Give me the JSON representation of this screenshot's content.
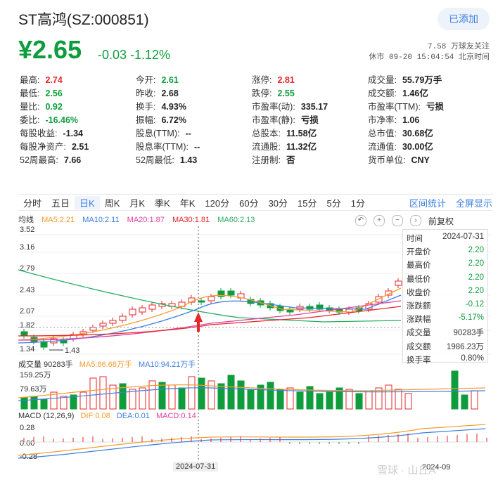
{
  "header": {
    "title": "ST高鸿(SZ:000851)",
    "add_button": "已添加",
    "price": "¥2.65",
    "change": "-0.03 -1.12%",
    "followers": "7.58 万球友关注",
    "market_status": "休市 09-20 15:04:54 北京时间"
  },
  "stats": [
    [
      {
        "label": "最高:",
        "value": "2.74",
        "color": "red"
      },
      {
        "label": "今开:",
        "value": "2.61",
        "color": "green"
      },
      {
        "label": "涨停:",
        "value": "2.81",
        "color": "red"
      },
      {
        "label": "成交量:",
        "value": "55.79万手",
        "color": ""
      }
    ],
    [
      {
        "label": "最低:",
        "value": "2.56",
        "color": "green"
      },
      {
        "label": "昨收:",
        "value": "2.68",
        "color": ""
      },
      {
        "label": "跌停:",
        "value": "2.55",
        "color": "green"
      },
      {
        "label": "成交额:",
        "value": "1.46亿",
        "color": ""
      }
    ],
    [
      {
        "label": "量比:",
        "value": "0.92",
        "color": "green"
      },
      {
        "label": "换手:",
        "value": "4.93%",
        "color": ""
      },
      {
        "label": "市盈率(动):",
        "value": "335.17",
        "color": ""
      },
      {
        "label": "市盈率(TTM):",
        "value": "亏损",
        "color": ""
      }
    ],
    [
      {
        "label": "委比:",
        "value": "-16.46%",
        "color": "green"
      },
      {
        "label": "振幅:",
        "value": "6.72%",
        "color": ""
      },
      {
        "label": "市盈率(静):",
        "value": "亏损",
        "color": ""
      },
      {
        "label": "市净率:",
        "value": "1.06",
        "color": ""
      }
    ],
    [
      {
        "label": "每股收益:",
        "value": "-1.34",
        "color": ""
      },
      {
        "label": "股息(TTM):",
        "value": "--",
        "color": ""
      },
      {
        "label": "总股本:",
        "value": "11.58亿",
        "color": ""
      },
      {
        "label": "总市值:",
        "value": "30.68亿",
        "color": ""
      }
    ],
    [
      {
        "label": "每股净资产:",
        "value": "2.51",
        "color": ""
      },
      {
        "label": "股息率(TTM):",
        "value": "--",
        "color": ""
      },
      {
        "label": "流通股:",
        "value": "11.32亿",
        "color": ""
      },
      {
        "label": "流通值:",
        "value": "30.00亿",
        "color": ""
      }
    ],
    [
      {
        "label": "52周最高:",
        "value": "7.66",
        "color": ""
      },
      {
        "label": "52周最低:",
        "value": "1.43",
        "color": ""
      },
      {
        "label": "注册制:",
        "value": "否",
        "color": ""
      },
      {
        "label": "货币单位:",
        "value": "CNY",
        "color": ""
      }
    ]
  ],
  "tabs": [
    "分时",
    "五日",
    "日K",
    "周K",
    "月K",
    "季K",
    "年K",
    "120分",
    "60分",
    "30分",
    "15分",
    "5分",
    "1分"
  ],
  "tab_actions": [
    "区间统计",
    "全屏显示"
  ],
  "ma_legend": {
    "label": "均线",
    "ma5": "MA5:2.21",
    "ma10": "MA10:2.11",
    "ma20": "MA20:1.87",
    "ma30": "MA30:1.81",
    "ma60": "MA60:2.13"
  },
  "controls": {
    "reset": "↶",
    "zoom_in": "+",
    "zoom_out": "−",
    "scroll_right": "›",
    "adjust": "前复权"
  },
  "tooltip": [
    {
      "k": "时间",
      "v": "2024-07-31",
      "c": ""
    },
    {
      "k": "开盘价",
      "v": "2.20",
      "c": "green"
    },
    {
      "k": "最高价",
      "v": "2.20",
      "c": "green"
    },
    {
      "k": "最低价",
      "v": "2.20",
      "c": "green"
    },
    {
      "k": "收盘价",
      "v": "2.20",
      "c": "green"
    },
    {
      "k": "涨跌额",
      "v": "-0.12",
      "c": "green"
    },
    {
      "k": "涨跌幅",
      "v": "-5.17%",
      "c": "green"
    },
    {
      "k": "成交量",
      "v": "90283手",
      "c": ""
    },
    {
      "k": "成交额",
      "v": "1986.23万",
      "c": ""
    },
    {
      "k": "换手率",
      "v": "0.80%",
      "c": ""
    }
  ],
  "price_axis": [
    "3.52",
    "3.16",
    "2.79",
    "2.43",
    "2.07",
    "1.82",
    "1.34"
  ],
  "low_marker": "1.43",
  "volume_legend": {
    "label": "成交量 90283手",
    "ma5": "MA5:86.68万手",
    "ma10": "MA10:94.21万手"
  },
  "volume_axis": [
    "159.25万",
    "79.63万"
  ],
  "macd_legend": {
    "label": "MACD (12,26,9)",
    "dif": "DIF:0.08",
    "dea": "DEA:0.01",
    "macd": "MACD:0.14"
  },
  "macd_axis": [
    "0.28",
    "0.00",
    "-0.28"
  ],
  "date_badge": "2024-07-31",
  "date_right": "2024-09",
  "watermark": "雪球 · 山丘A",
  "colors": {
    "up": "#e5262a",
    "down": "#0e9c3c",
    "accent": "#3c7ee2",
    "ma5": "#f39c2c",
    "ma10": "#3c7ee2",
    "ma20": "#e040a0",
    "ma30": "#e5262a",
    "ma60": "#27ae60"
  }
}
